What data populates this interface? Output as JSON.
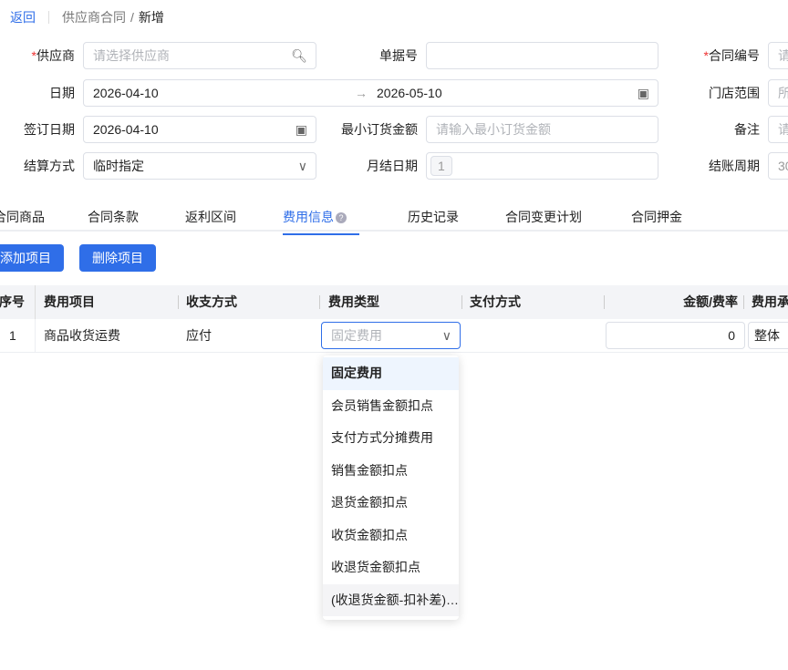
{
  "breadcrumb": {
    "back": "返回",
    "parent": "供应商合同",
    "current": "新增"
  },
  "form": {
    "supplier": {
      "label": "供应商",
      "placeholder": "请选择供应商"
    },
    "doc_no": {
      "label": "单据号",
      "value": ""
    },
    "contract_no": {
      "label": "合同编号",
      "placeholder": "请"
    },
    "date": {
      "label": "日期",
      "start": "2026-04-10",
      "end": "2026-05-10",
      "arrow": "→"
    },
    "store_range": {
      "label": "门店范围",
      "placeholder": "所"
    },
    "sign_date": {
      "label": "签订日期",
      "value": "2026-04-10"
    },
    "min_order": {
      "label": "最小订货金额",
      "placeholder": "请输入最小订货金额"
    },
    "remark": {
      "label": "备注",
      "placeholder": "请"
    },
    "settle_method": {
      "label": "结算方式",
      "value": "临时指定"
    },
    "month_day": {
      "label": "月结日期",
      "value": "1"
    },
    "settle_cycle": {
      "label": "结账周期",
      "value": "30"
    }
  },
  "tabs": [
    "合同商品",
    "合同条款",
    "返利区间",
    "费用信息",
    "历史记录",
    "合同变更计划",
    "合同押金"
  ],
  "active_tab": "费用信息",
  "buttons": {
    "add": "添加项目",
    "delete": "删除项目"
  },
  "table": {
    "columns": [
      "序号",
      "费用项目",
      "收支方式",
      "费用类型",
      "支付方式",
      "金额/费率",
      "费用承担"
    ],
    "rows": [
      {
        "index": "1",
        "item": "商品收货运费",
        "direction": "应付",
        "type_placeholder": "固定费用",
        "payment": "",
        "amount": "0",
        "scope": "整体"
      }
    ]
  },
  "dropdown": {
    "options": [
      "固定费用",
      "会员销售金额扣点",
      "支付方式分摊费用",
      "销售金额扣点",
      "退货金额扣点",
      "收货金额扣点",
      "收退货金额扣点",
      "(收退货金额-扣补差)扣点"
    ],
    "selected": "固定费用"
  },
  "colors": {
    "primary": "#2f6ee8",
    "required": "#e33"
  }
}
